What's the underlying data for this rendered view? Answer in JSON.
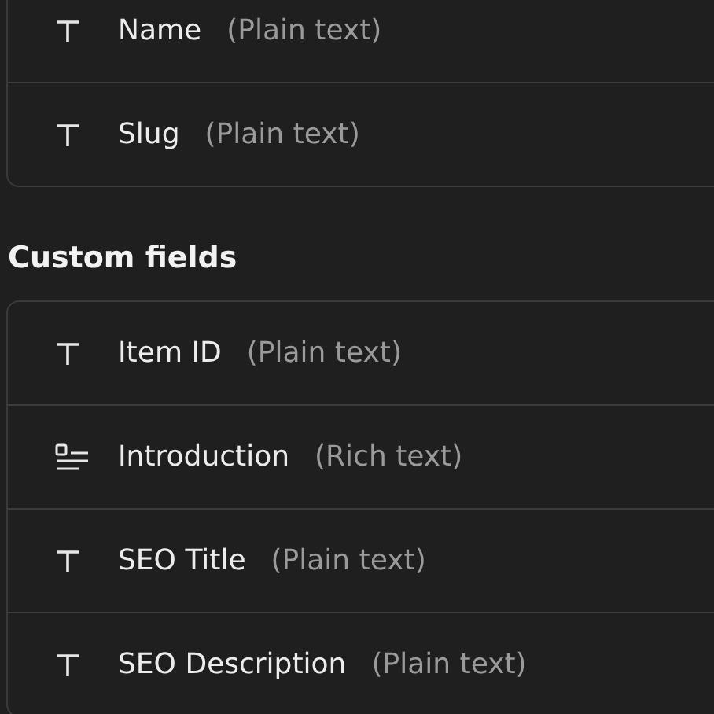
{
  "sections": [
    {
      "fields": [
        {
          "name": "Name",
          "type": "(Plain text)",
          "kind": "plain"
        },
        {
          "name": "Slug",
          "type": "(Plain text)",
          "kind": "plain"
        }
      ]
    },
    {
      "heading": "Custom fields",
      "fields": [
        {
          "name": "Item ID",
          "type": "(Plain text)",
          "kind": "plain"
        },
        {
          "name": "Introduction",
          "type": "(Rich text)",
          "kind": "rich"
        },
        {
          "name": "SEO Title",
          "type": "(Plain text)",
          "kind": "plain"
        },
        {
          "name": "SEO Description",
          "type": "(Plain text)",
          "kind": "plain"
        }
      ]
    }
  ]
}
